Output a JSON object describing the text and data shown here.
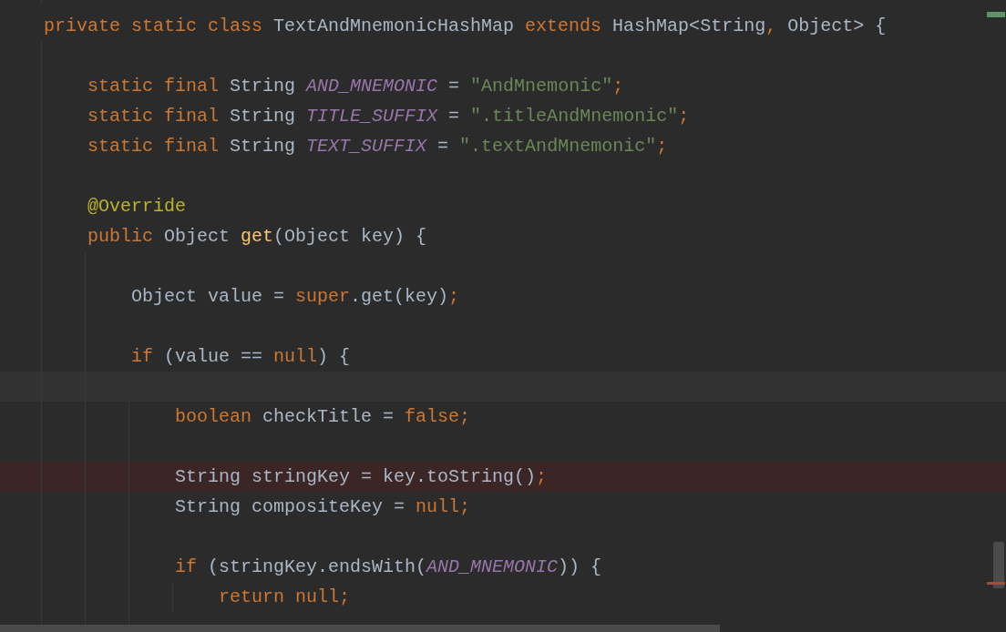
{
  "editor": {
    "lines": [
      {
        "kind": "plain",
        "tokens": [
          {
            "kind": "keyword",
            "text": "private static class "
          },
          {
            "kind": "plain",
            "text": "TextAndMnemonicHashMap "
          },
          {
            "kind": "keyword",
            "text": "extends "
          },
          {
            "kind": "plain",
            "text": "HashMap<String"
          },
          {
            "kind": "keyword",
            "text": ","
          },
          {
            "kind": "plain",
            "text": " Object> {"
          }
        ]
      },
      {
        "kind": "plain"
      },
      {
        "kind": "plain",
        "tokens": [
          {
            "kind": "keyword",
            "text": "    static final "
          },
          {
            "kind": "plain",
            "text": "String "
          },
          {
            "kind": "constant",
            "text": "AND_MNEMONIC"
          },
          {
            "kind": "plain",
            "text": " = "
          },
          {
            "kind": "string",
            "text": "\"AndMnemonic\""
          },
          {
            "kind": "keyword",
            "text": ";"
          }
        ]
      },
      {
        "kind": "plain",
        "tokens": [
          {
            "kind": "keyword",
            "text": "    static final "
          },
          {
            "kind": "plain",
            "text": "String "
          },
          {
            "kind": "constant",
            "text": "TITLE_SUFFIX"
          },
          {
            "kind": "plain",
            "text": " = "
          },
          {
            "kind": "string",
            "text": "\".titleAndMnemonic\""
          },
          {
            "kind": "keyword",
            "text": ";"
          }
        ]
      },
      {
        "kind": "plain",
        "tokens": [
          {
            "kind": "keyword",
            "text": "    static final "
          },
          {
            "kind": "plain",
            "text": "String "
          },
          {
            "kind": "constant",
            "text": "TEXT_SUFFIX"
          },
          {
            "kind": "plain",
            "text": " = "
          },
          {
            "kind": "string",
            "text": "\".textAndMnemonic\""
          },
          {
            "kind": "keyword",
            "text": ";"
          }
        ]
      },
      {
        "kind": "plain"
      },
      {
        "kind": "plain",
        "tokens": [
          {
            "kind": "annotation",
            "text": "    @Override"
          }
        ]
      },
      {
        "kind": "plain",
        "tokens": [
          {
            "kind": "keyword",
            "text": "    public "
          },
          {
            "kind": "plain",
            "text": "Object "
          },
          {
            "kind": "method",
            "text": "get"
          },
          {
            "kind": "plain",
            "text": "(Object key) {"
          }
        ]
      },
      {
        "kind": "plain"
      },
      {
        "kind": "plain",
        "tokens": [
          {
            "kind": "plain",
            "text": "        Object value = "
          },
          {
            "kind": "keyword",
            "text": "super"
          },
          {
            "kind": "plain",
            "text": ".get(key)"
          },
          {
            "kind": "keyword",
            "text": ";"
          }
        ]
      },
      {
        "kind": "plain"
      },
      {
        "kind": "plain",
        "tokens": [
          {
            "kind": "keyword",
            "text": "        if "
          },
          {
            "kind": "plain",
            "text": "(value == "
          },
          {
            "kind": "keyword",
            "text": "null"
          },
          {
            "kind": "plain",
            "text": ") {"
          }
        ]
      },
      {
        "kind": "caret"
      },
      {
        "kind": "plain",
        "tokens": [
          {
            "kind": "keyword",
            "text": "            boolean "
          },
          {
            "kind": "plain",
            "text": "checkTitle = "
          },
          {
            "kind": "keyword",
            "text": "false;"
          }
        ]
      },
      {
        "kind": "plain"
      },
      {
        "kind": "error",
        "tokens": [
          {
            "kind": "plain",
            "text": "            String stringKey = key.toString()"
          },
          {
            "kind": "keyword",
            "text": ";"
          }
        ]
      },
      {
        "kind": "plain",
        "tokens": [
          {
            "kind": "plain",
            "text": "            String compositeKey = "
          },
          {
            "kind": "keyword",
            "text": "null;"
          }
        ]
      },
      {
        "kind": "plain"
      },
      {
        "kind": "plain",
        "tokens": [
          {
            "kind": "keyword",
            "text": "            if "
          },
          {
            "kind": "plain",
            "text": "(stringKey.endsWith("
          },
          {
            "kind": "constant",
            "text": "AND_MNEMONIC"
          },
          {
            "kind": "plain",
            "text": ")) {"
          }
        ]
      },
      {
        "kind": "plain",
        "tokens": [
          {
            "kind": "keyword",
            "text": "                return null;"
          }
        ]
      }
    ]
  }
}
